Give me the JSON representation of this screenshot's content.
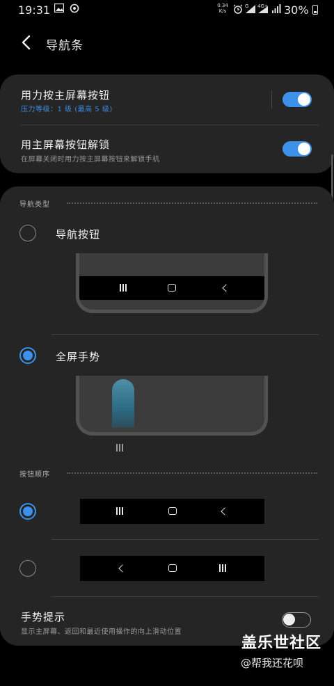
{
  "status_bar": {
    "time": "19:31",
    "net_speed_value": "0.34",
    "net_speed_unit": "K/s",
    "signal_label_1": "G",
    "signal_label_2": "4G+",
    "battery": "30%"
  },
  "header": {
    "title": "导航条"
  },
  "settings": {
    "press_home": {
      "title": "用力按主屏幕按钮",
      "subtitle": "压力等级：1 级 (最高 5 级)",
      "enabled": true
    },
    "unlock_home": {
      "title": "用主屏幕按钮解锁",
      "subtitle": "在屏幕关闭时用力按主屏幕按钮来解锁手机",
      "enabled": true
    }
  },
  "navigation_type": {
    "header": "导航类型",
    "options": [
      {
        "label": "导航按钮",
        "selected": false
      },
      {
        "label": "全屏手势",
        "selected": true
      }
    ]
  },
  "button_order": {
    "header": "按钮顺序",
    "options": [
      {
        "order": [
          "recents",
          "home",
          "back"
        ],
        "selected": true
      },
      {
        "order": [
          "back",
          "home",
          "recents"
        ],
        "selected": false
      }
    ]
  },
  "gesture_hint": {
    "title": "手势提示",
    "subtitle": "显示主屏幕、返回和最近使用操作的向上滑动位置",
    "enabled": false
  },
  "watermark": {
    "title": "盖乐世社区",
    "user": "@帮我还花呗"
  },
  "colors": {
    "accent": "#3e91ea",
    "background": "#000000",
    "card": "#252525"
  }
}
